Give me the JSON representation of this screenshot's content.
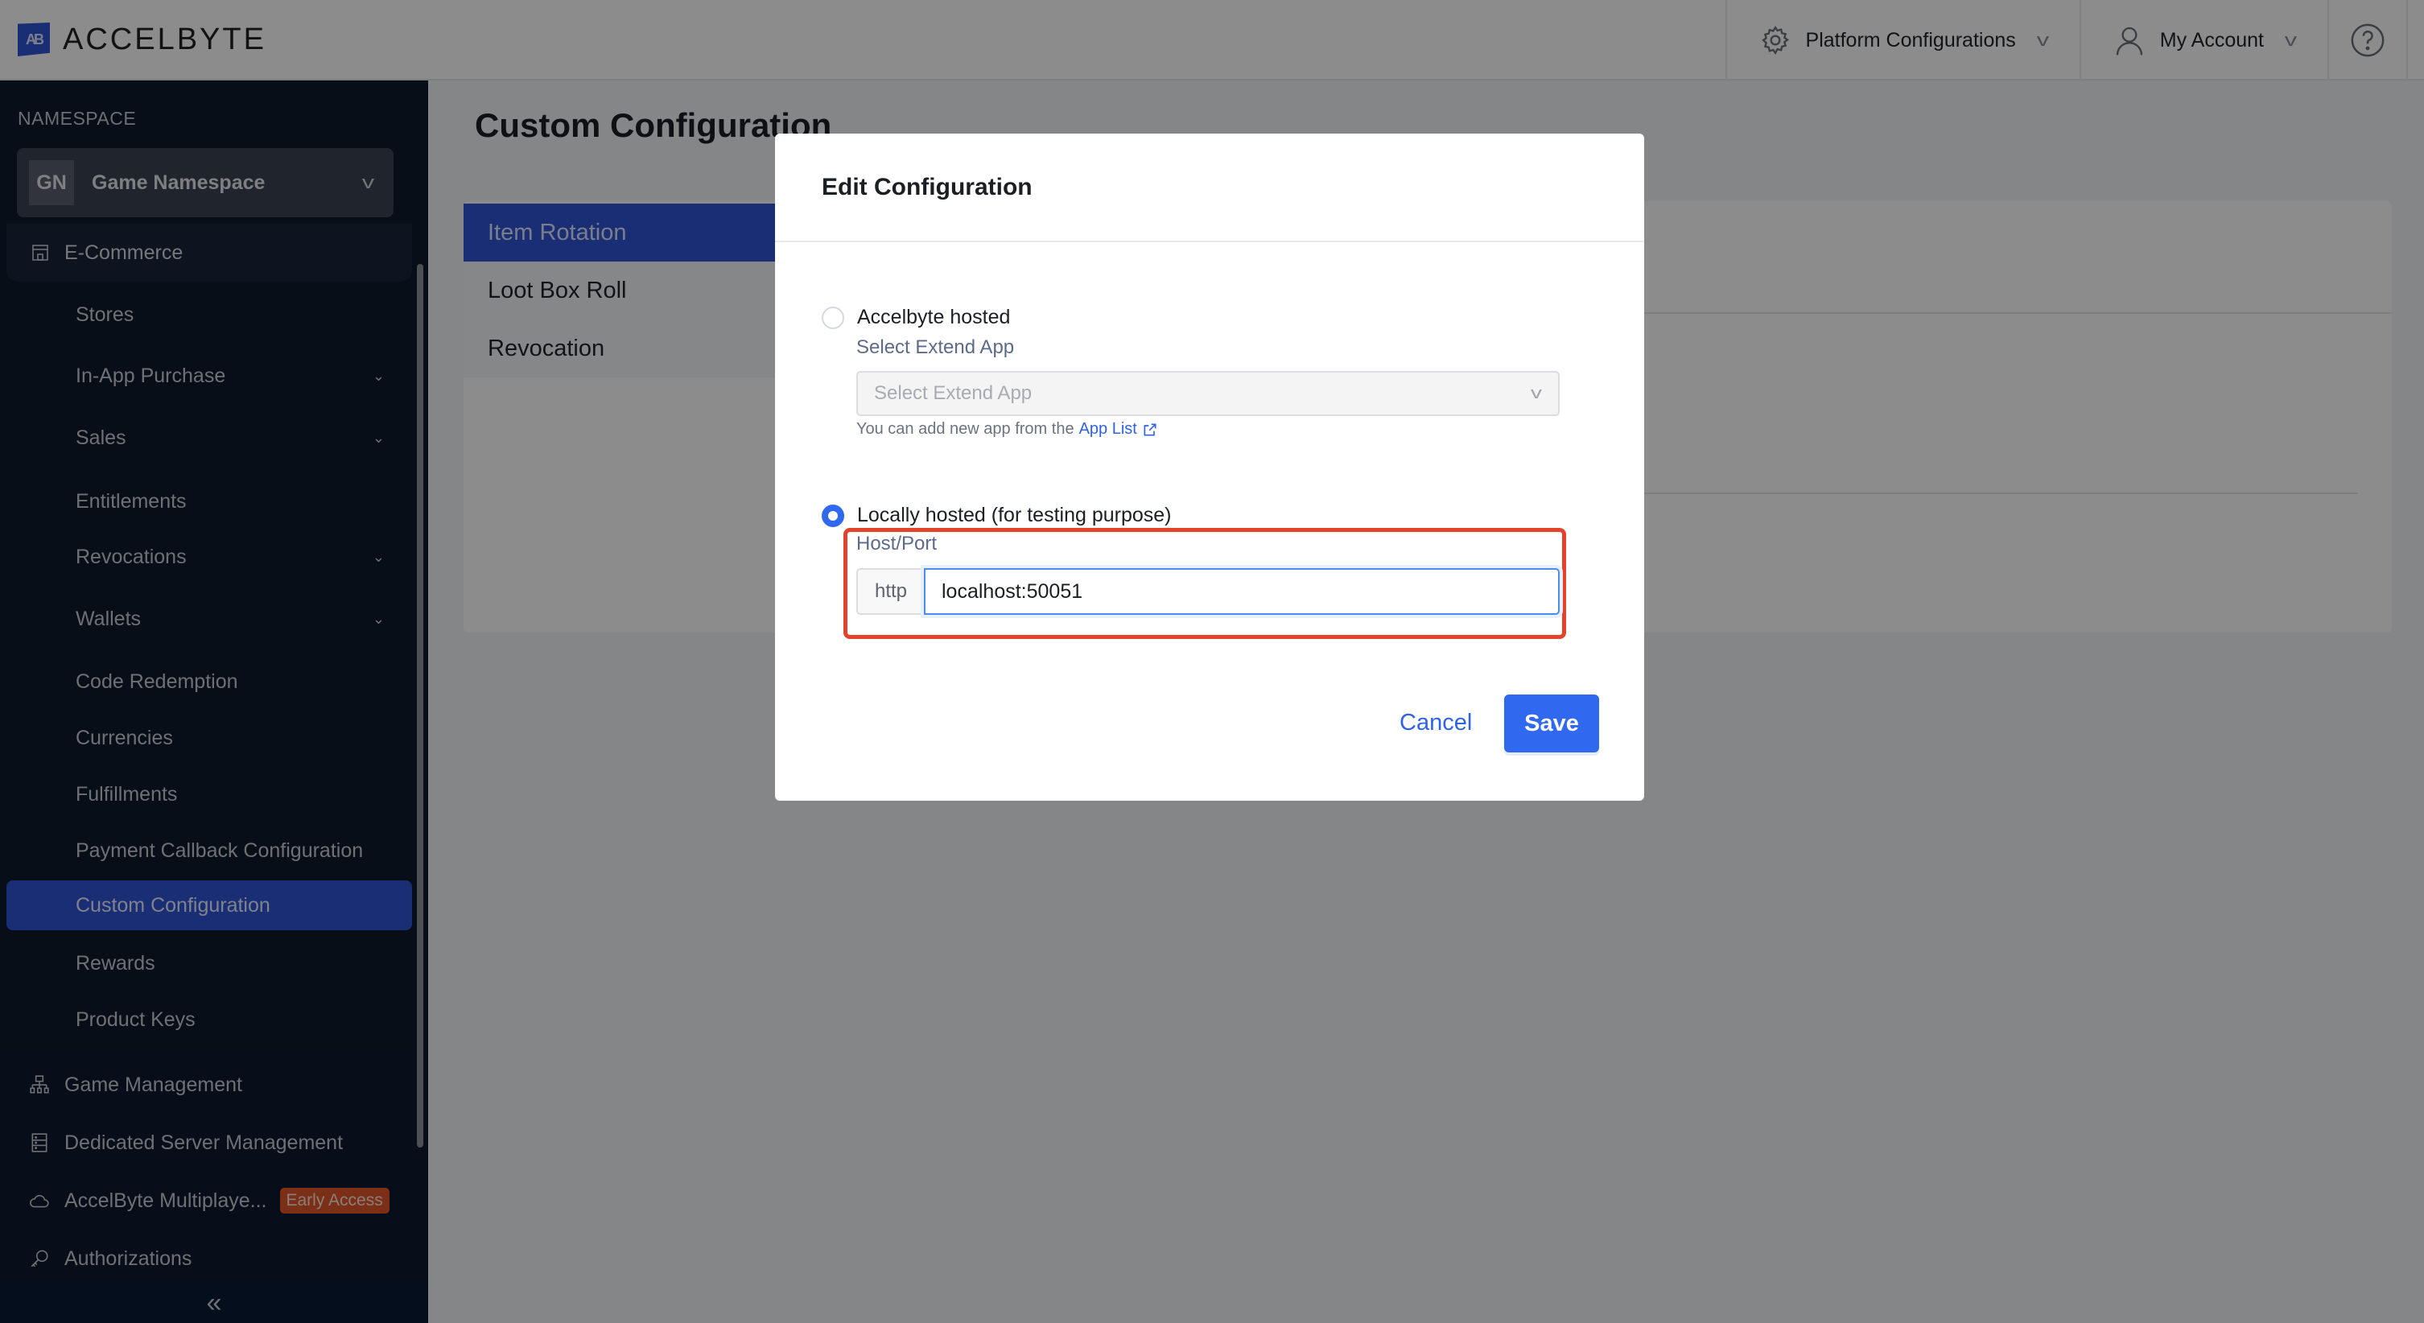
{
  "header": {
    "logo_text": "ACCELBYTE",
    "logo_mark": "AB",
    "platform_configurations": "Platform Configurations",
    "my_account": "My Account",
    "help_icon": "?"
  },
  "sidebar": {
    "namespace_label": "NAMESPACE",
    "namespace_badge": "GN",
    "namespace_name": "Game Namespace",
    "section": "E-Commerce",
    "sub_items": [
      {
        "label": "Stores",
        "has_chevron": false
      },
      {
        "label": "In-App Purchase",
        "has_chevron": true
      },
      {
        "label": "Sales",
        "has_chevron": true
      },
      {
        "label": "Entitlements",
        "has_chevron": false
      },
      {
        "label": "Revocations",
        "has_chevron": true
      },
      {
        "label": "Wallets",
        "has_chevron": true
      },
      {
        "label": "Code Redemption",
        "has_chevron": false
      },
      {
        "label": "Currencies",
        "has_chevron": false
      },
      {
        "label": "Fulfillments",
        "has_chevron": false
      },
      {
        "label": "Payment Callback Configuration",
        "has_chevron": false
      },
      {
        "label": "Custom Configuration",
        "has_chevron": false,
        "active": true
      },
      {
        "label": "Rewards",
        "has_chevron": false
      },
      {
        "label": "Product Keys",
        "has_chevron": false
      }
    ],
    "main_items": [
      {
        "label": "Game Management",
        "icon": "sitemap-icon"
      },
      {
        "label": "Dedicated Server Management",
        "icon": "server-icon"
      },
      {
        "label": "AccelByte Multiplaye...",
        "icon": "cloud-icon",
        "badge": "Early Access"
      },
      {
        "label": "Authorizations",
        "icon": "key-icon"
      }
    ],
    "collapse_icon": "«"
  },
  "main": {
    "title": "Custom Configuration",
    "tabs": [
      {
        "label": "Item Rotation",
        "active": true
      },
      {
        "label": "Loot Box Roll",
        "active": false
      },
      {
        "label": "Revocation",
        "active": false
      }
    ]
  },
  "modal": {
    "title": "Edit Configuration",
    "option_hosted": "Accelbyte hosted",
    "select_label": "Select Extend App",
    "select_placeholder": "Select Extend App",
    "helper_text": "You can add new app from the",
    "helper_link": "App List",
    "option_local": "Locally hosted (for testing purpose)",
    "selected_option": "local",
    "host_label": "Host/Port",
    "protocol": "http",
    "host_value": "localhost:50051",
    "cancel": "Cancel",
    "save": "Save"
  },
  "colors": {
    "accent": "#3069f0",
    "sidebar_bg": "#0f1a2b",
    "active_nav": "#2f55d4",
    "highlight_box": "#e4432b",
    "early_access_badge": "#e0572a"
  }
}
